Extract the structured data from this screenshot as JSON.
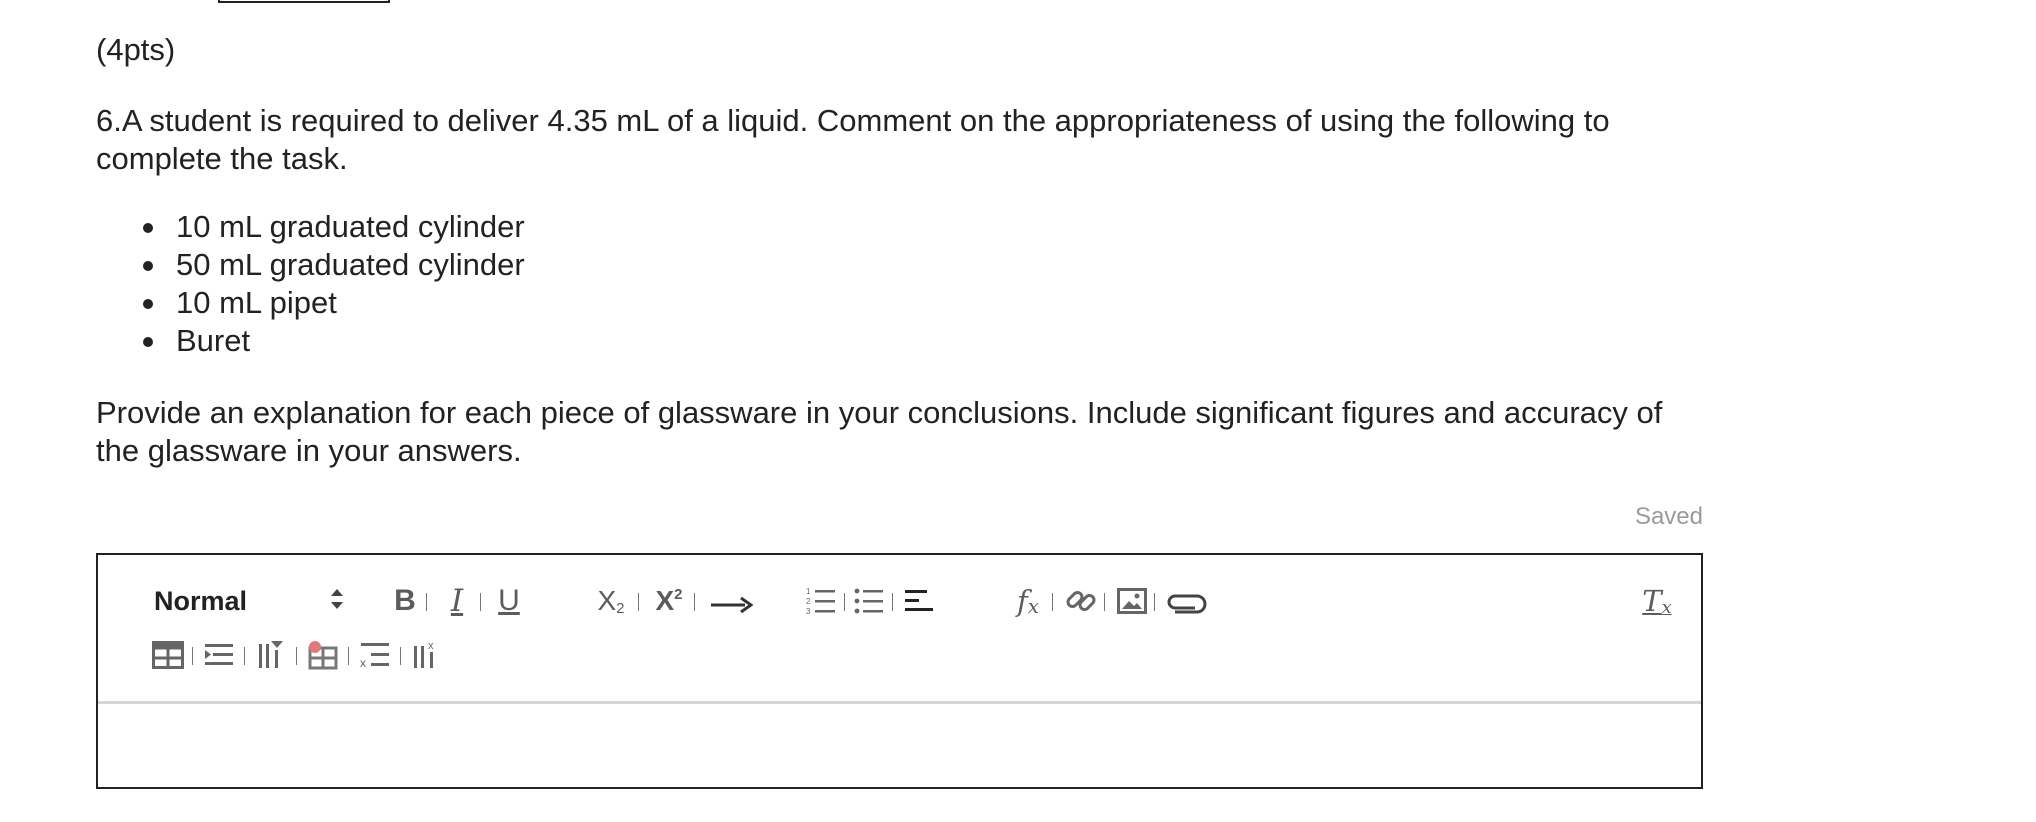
{
  "question": {
    "points": "(4pts)",
    "prompt": "6.A student is required to deliver 4.35 mL of a liquid. Comment on the appropriateness of using the following to complete the task.",
    "items": [
      "10 mL graduated cylinder",
      "50 mL graduated cylinder",
      "10 mL pipet",
      "Buret"
    ],
    "instructions": "Provide an explanation for each piece of glassware in your conclusions. Include significant figures and accuracy of the glassware in your answers."
  },
  "status": {
    "saved": "Saved"
  },
  "editor": {
    "format_select": "Normal",
    "content": "",
    "toolbar_row1": [
      "bold-icon",
      "italic-icon",
      "underline-icon",
      "subscript-icon",
      "superscript-icon",
      "arrow-icon",
      "ordered-list-icon",
      "bullet-list-icon",
      "align-left-icon",
      "formula-icon",
      "link-icon",
      "image-icon",
      "attachment-icon",
      "clear-format-icon"
    ],
    "toolbar_row2": [
      "table-icon",
      "insert-row-icon",
      "insert-column-icon",
      "delete-table-icon",
      "delete-row-icon",
      "delete-column-icon"
    ]
  }
}
